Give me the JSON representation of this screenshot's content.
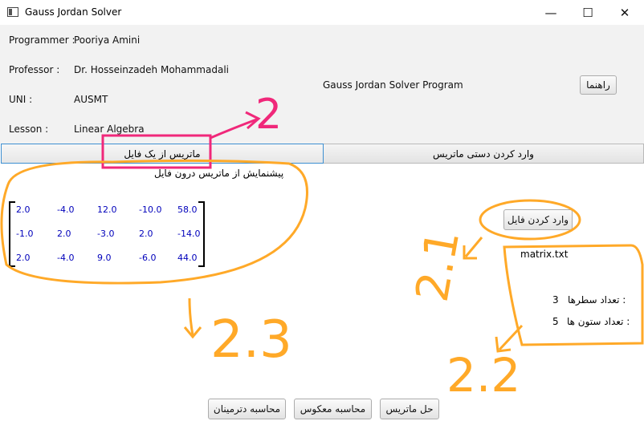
{
  "window": {
    "title": "Gauss Jordan Solver",
    "minimize": "—",
    "maximize": "☐",
    "close": "✕"
  },
  "info": [
    {
      "label": "Programmer :",
      "value": "Pooriya Amini"
    },
    {
      "label": "Professor :",
      "value": "Dr. Hosseinzadeh Mohammadali"
    },
    {
      "label": "UNI :",
      "value": "AUSMT"
    },
    {
      "label": "Lesson :",
      "value": "Linear Algebra"
    }
  ],
  "program_title": "Gauss Jordan Solver Program",
  "help_button": "راهنما",
  "tabs": [
    {
      "label": "ماتریس از یک فایل",
      "selected": true
    },
    {
      "label": "وارد کردن دستی ماتریس",
      "selected": false
    }
  ],
  "preview_title": "پیشنمایش از ماتریس درون فایل",
  "matrix": {
    "rows": [
      [
        "2.0",
        "-4.0",
        "12.0",
        "-10.0",
        "58.0"
      ],
      [
        "-1.0",
        "2.0",
        "-3.0",
        "2.0",
        "-14.0"
      ],
      [
        "2.0",
        "-4.0",
        "9.0",
        "-6.0",
        "44.0"
      ]
    ]
  },
  "load_file_button": "وارد کردن فایل",
  "file_name": "matrix.txt",
  "rows_label": "تعداد سطرها :",
  "rows_value": "3",
  "cols_label": "تعداد ستون ها :",
  "cols_value": "5",
  "bottom_buttons": {
    "determinant": "محاسبه دترمینان",
    "inverse": "محاسبه معکوس",
    "solve": "حل ماتریس"
  },
  "annotations": [
    "2",
    "2.1",
    "2.2",
    "2.3"
  ],
  "colors": {
    "annotation_orange": "#ffa928",
    "annotation_pink": "#f0287a",
    "tab_focus": "#3d8fd1",
    "matrix_text": "#0000bb"
  }
}
